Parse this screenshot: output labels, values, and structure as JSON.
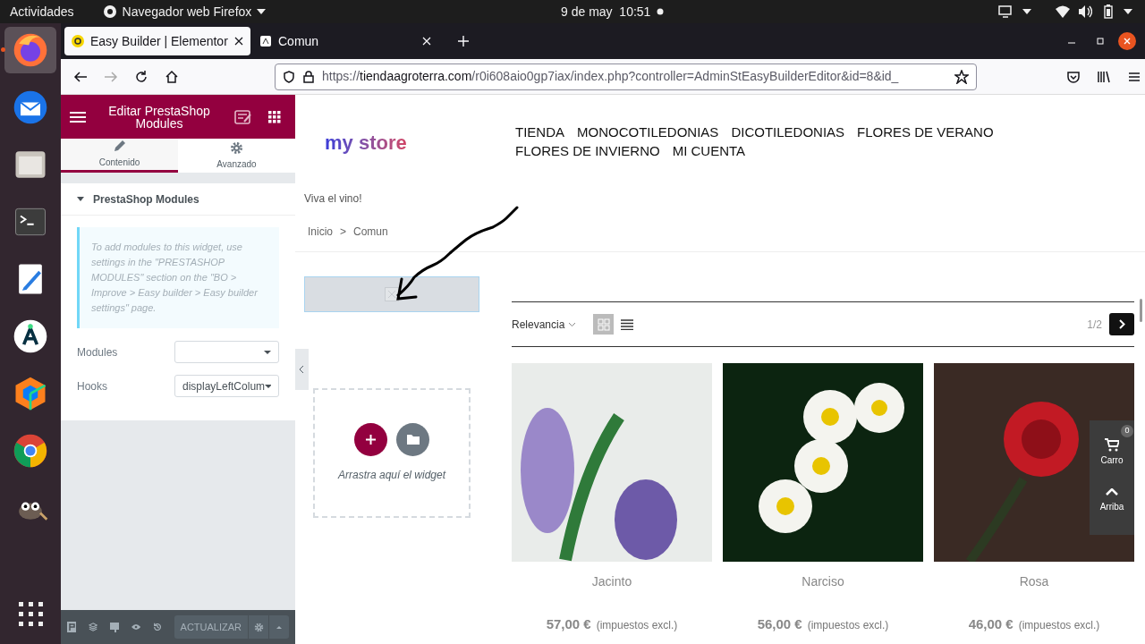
{
  "system_bar": {
    "activities": "Actividades",
    "app_menu": "Navegador web Firefox",
    "clock": "9 de may  10:51"
  },
  "dock": [
    {
      "kind": "firefox",
      "selected": true
    },
    {
      "kind": "mail",
      "selected": false
    },
    {
      "kind": "files",
      "selected": false
    },
    {
      "kind": "terminal",
      "selected": false
    },
    {
      "kind": "editor",
      "selected": false
    },
    {
      "kind": "android",
      "selected": false
    },
    {
      "kind": "cube",
      "selected": false
    },
    {
      "kind": "chrome",
      "selected": false
    },
    {
      "kind": "gimp",
      "selected": false
    }
  ],
  "browser": {
    "tabs": [
      {
        "title": "Easy Builder | Elementor",
        "selected": true
      },
      {
        "title": "Comun",
        "selected": false
      }
    ],
    "url": {
      "scheme": "https://",
      "host": "tiendaagroterra.com",
      "path": "/r0i608aio0gp7iax/index.php?controller=AdminStEasyBuilderEditor&id=8&id_"
    }
  },
  "editor": {
    "title": "Editar PrestaShop Modules",
    "tabs": [
      {
        "label": "Contenido",
        "kind": "pencil",
        "selected": true
      },
      {
        "label": "Avanzado",
        "kind": "gear",
        "selected": false
      }
    ],
    "section": {
      "title": "PrestaShop Modules",
      "expanded": true
    },
    "notice": "To add modules to this widget, use settings in the \"PRESTASHOP MODULES\" section on the \"BO > Improve > Easy builder > Easy builder settings\" page.",
    "fields": [
      {
        "label": "Modules"
      },
      {
        "label": "Hooks",
        "value": "displayLeftColum"
      }
    ],
    "footer": {
      "button": "ACTUALIZAR"
    }
  },
  "store": {
    "logo": "my store",
    "menu": [
      "TIENDA",
      "MONOCOTILEDONIAS",
      "DICOTILEDONIAS",
      "FLORES DE VERANO",
      "FLORES DE INVIERNO",
      "MI CUENTA"
    ],
    "tagline": "Viva el vino!",
    "breadcrumb": {
      "items": [
        "Inicio",
        "Comun"
      ],
      "separator": ">"
    },
    "dropzone": {
      "hint": "Arrastra aquí el widget"
    },
    "sort": {
      "label": "Relevancia"
    },
    "views": [
      {
        "kind": "grid",
        "selected": true
      },
      {
        "kind": "list",
        "selected": false
      }
    ],
    "pagination": "1/2",
    "products": [
      {
        "name": "Jacinto",
        "price": "57,00 €",
        "tax_note": "(impuestos excl.)"
      },
      {
        "name": "Narciso",
        "price": "56,00 €",
        "tax_note": "(impuestos excl.)"
      },
      {
        "name": "Rosa",
        "price": "46,00 €",
        "tax_note": "(impuestos excl.)"
      }
    ],
    "floating": {
      "cart_label": "Carro",
      "cart_count": "0",
      "top_label": "Arriba"
    }
  }
}
